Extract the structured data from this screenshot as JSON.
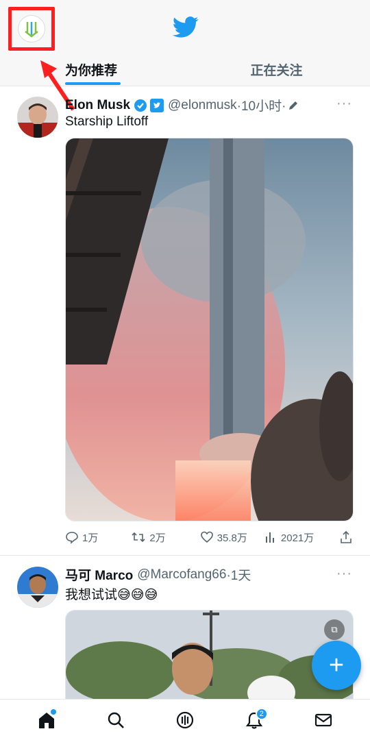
{
  "header": {
    "tabs": [
      {
        "label": "为你推荐",
        "active": true
      },
      {
        "label": "正在关注",
        "active": false
      }
    ],
    "accent_color": "#1d9bf0"
  },
  "tweets": [
    {
      "name": "Elon Musk",
      "handle": "@elonmusk",
      "time": "·10小时·",
      "verified": true,
      "text": "Starship Liftoff",
      "actions": {
        "replies": "1万",
        "retweets": "2万",
        "likes": "35.8万",
        "views": "2021万"
      }
    },
    {
      "name": "马可 Marco",
      "handle": "@Marcofang66",
      "time": "·1天",
      "text": "我想试试😅😅😅"
    }
  ],
  "icons": {
    "nav": [
      "home-icon",
      "search-icon",
      "spaces-icon",
      "notifications-icon",
      "messages-icon"
    ]
  },
  "notifications_badge": "2",
  "fab_label": "+"
}
